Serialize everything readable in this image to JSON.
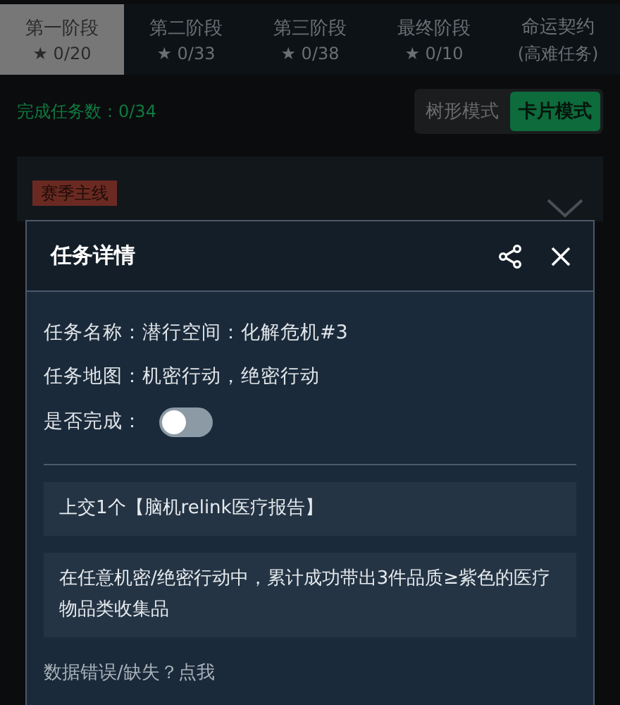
{
  "tabs": [
    {
      "label": "第一阶段",
      "sub": "★ 0/20",
      "selected": true
    },
    {
      "label": "第二阶段",
      "sub": "★ 0/33",
      "selected": false
    },
    {
      "label": "第三阶段",
      "sub": "★ 0/38",
      "selected": false
    },
    {
      "label": "最终阶段",
      "sub": "★ 0/10",
      "selected": false
    },
    {
      "label": "命运契约",
      "sub": "(高难任务)",
      "selected": false
    }
  ],
  "progress": "完成任务数：0/34",
  "view_modes": [
    {
      "label": "树形模式",
      "selected": false
    },
    {
      "label": "卡片模式",
      "selected": true
    }
  ],
  "card": {
    "tag": "赛季主线"
  },
  "dialog": {
    "title": "任务详情",
    "fields": [
      "任务名称：潜行空间：化解危机#3",
      "任务地图：机密行动，绝密行动"
    ],
    "completed": {
      "label": "是否完成：",
      "on": false
    },
    "objectives": [
      "上交1个【脑机relink医疗报告】",
      "在任意机密/绝密行动中，累计成功带出3件品质≥紫色的医疗物品类收集品"
    ],
    "footer": "数据错误/缺失？点我"
  }
}
